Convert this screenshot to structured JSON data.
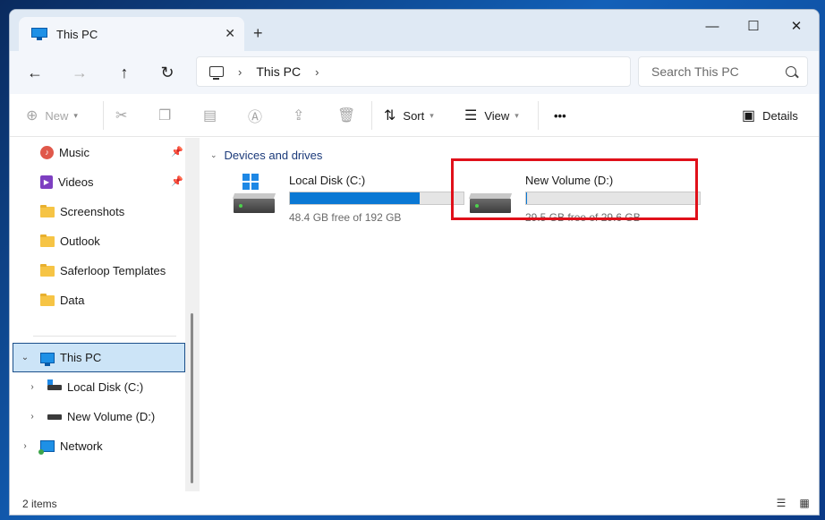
{
  "window": {
    "tab_title": "This PC",
    "tab_icon": "this-pc-icon",
    "new_tab": "+",
    "controls": {
      "minimize": "—",
      "maximize": "☐",
      "close": "✕"
    }
  },
  "nav": {
    "back": "←",
    "forward": "→",
    "up": "↑",
    "refresh": "↻",
    "breadcrumb": [
      "This PC"
    ],
    "search_placeholder": "Search This PC"
  },
  "commands": {
    "new": "New",
    "sort": "Sort",
    "view": "View",
    "more": "•••",
    "details": "Details"
  },
  "sidebar": {
    "quick_access": [
      {
        "label": "Music",
        "icon": "music-icon",
        "pinned": true
      },
      {
        "label": "Videos",
        "icon": "videos-icon",
        "pinned": true
      },
      {
        "label": "Screenshots",
        "icon": "folder-icon",
        "pinned": false
      },
      {
        "label": "Outlook",
        "icon": "folder-icon",
        "pinned": false
      },
      {
        "label": "Saferloop Templates",
        "icon": "folder-icon",
        "pinned": false
      },
      {
        "label": "Data",
        "icon": "folder-icon",
        "pinned": false
      }
    ],
    "tree": [
      {
        "label": "This PC",
        "icon": "this-pc-icon",
        "expanded": true,
        "selected": true
      },
      {
        "label": "Local Disk (C:)",
        "icon": "drive-icon"
      },
      {
        "label": "New Volume (D:)",
        "icon": "drive-icon"
      },
      {
        "label": "Network",
        "icon": "network-icon"
      }
    ]
  },
  "content": {
    "group_label": "Devices and drives",
    "drives": [
      {
        "name": "Local Disk (C:)",
        "free_text": "48.4 GB free of 192 GB",
        "used_fraction": 0.748,
        "accent": "#0a78d4"
      },
      {
        "name": "New Volume (D:)",
        "free_text": "29.5 GB free of 29.6 GB",
        "used_fraction": 0.003,
        "accent": "#0a78d4"
      }
    ]
  },
  "status": {
    "items": "2 items"
  },
  "colors": {
    "highlight": "#e0101a",
    "selection": "#cce4f7",
    "accent": "#0a78d4"
  }
}
